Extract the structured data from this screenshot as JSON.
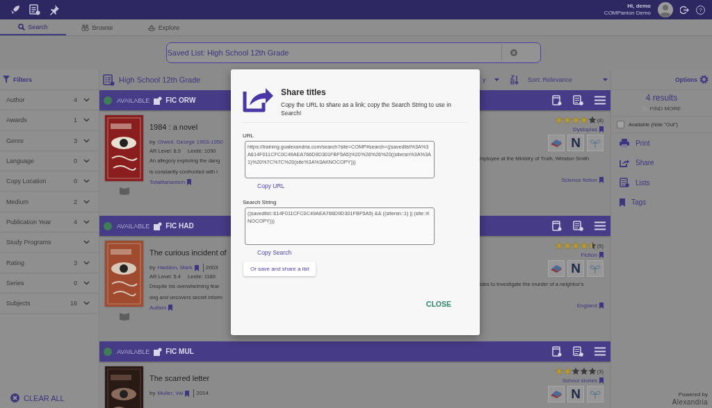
{
  "top_bar": {
    "greeting": "Hi, demo",
    "account": "COMPanion Demo",
    "help": "?"
  },
  "tabs": [
    {
      "label": "Search",
      "selected": true
    },
    {
      "label": "Browse",
      "selected": false
    },
    {
      "label": "Explore",
      "selected": false
    }
  ],
  "search": {
    "value": "Saved List: High School 12th Grade"
  },
  "filters": {
    "title": "Filters",
    "items": [
      {
        "label": "Author",
        "count": "4"
      },
      {
        "label": "Awards",
        "count": "1"
      },
      {
        "label": "Genre",
        "count": "3"
      },
      {
        "label": "Language",
        "count": "0"
      },
      {
        "label": "Copy Location",
        "count": "0"
      },
      {
        "label": "Medium",
        "count": "2"
      },
      {
        "label": "Publication Year",
        "count": "4"
      },
      {
        "label": "Study Programs"
      },
      {
        "label": "Rating",
        "count": "3"
      },
      {
        "label": "Series",
        "count": "0"
      },
      {
        "label": "Subjects",
        "count": "16"
      }
    ],
    "clear": "CLEAR ALL"
  },
  "results_header": {
    "list_name": "High School 12th Grade",
    "group_by": "y",
    "sort": "Sort: Relevance"
  },
  "results": [
    {
      "status": "AVAILABLE",
      "color": "#3f7d55",
      "call_number": "FIC ORW",
      "title": "1984 : a novel",
      "author_prefix": "by",
      "author": "Orwell, George 1903-1950",
      "author_bookmark": false,
      "ar_level": "AR Level: 8.9",
      "lexile": "Lexile: 1090",
      "description_left": [
        "An allegory exploring the dang",
        "is constantly confronted with l"
      ],
      "description_right": [
        "mployee at the Ministry of Truth, Winston Smith"
      ],
      "subject_left": "Totalitarianism",
      "subject_right": "Science fiction",
      "stars": 4,
      "rating_count": "(8)",
      "genre": "Dystopias",
      "resources": [
        {
          "kind": "books"
        },
        {
          "kind": "letter",
          "label": "N"
        },
        {
          "kind": "plant"
        }
      ]
    },
    {
      "status": "AVAILABLE",
      "color": "#3f7d55",
      "call_number": "FIC HAD",
      "title": "The curious incident of",
      "author_prefix": "by",
      "author": "Haddon, Mark",
      "author_bookmark": true,
      "year": "2003",
      "ar_level": "AR Level: 5.4",
      "lexile": "Lexile: 1180",
      "description_left": [
        "Despite his overwhelming fear",
        "dog and uncovers secret inform"
      ],
      "description_right": [
        "ides to investigate the murder of a neighbor's"
      ],
      "subject_left": "Autism",
      "subject_right": "England",
      "stars": 4.5,
      "rating_count": "(5)",
      "genre": "Fiction",
      "resources": [
        {
          "kind": "books"
        },
        {
          "kind": "letter",
          "label": "N"
        },
        {
          "kind": "plant"
        }
      ]
    },
    {
      "status": "AVAILABLE",
      "color": "#3f7d55",
      "call_number": "FIC MUL",
      "title": "The scarred letter",
      "author_prefix": "by",
      "author": "Muller, Val",
      "author_bookmark": true,
      "year": "2014",
      "stars": 2,
      "rating_count": "(3)",
      "genre": "School stories",
      "resources": [
        {
          "kind": "books"
        },
        {
          "kind": "letter",
          "label": "N"
        },
        {
          "kind": "plant"
        }
      ]
    }
  ],
  "options": {
    "title": "Options",
    "results_count": "4 results",
    "find_more": "FIND MORE",
    "available_filter": {
      "label": "Available (hide \"Out\")",
      "checked": false
    },
    "actions": [
      {
        "label": "Print"
      },
      {
        "label": "Share"
      },
      {
        "label": "Lists"
      },
      {
        "label": "Tags"
      }
    ]
  },
  "powered_by": {
    "label": "Powered by",
    "brand": "Alexandria"
  },
  "modal": {
    "title": "Share titles",
    "subtitle": "Copy the URL to share as a link; copy the Search String to use in Search!",
    "url_label": "URL",
    "url": "https://training.goalexandria.com/search?site=COMP#search=((savedlist%3A%3A614F011CFC0C49AEA766D9D301FBF5A5)%20%26%26%20((sitersn%3A%3A1)%20%7C%7C%20(site%3A%3AKNOCOPY)))",
    "copy_url": "Copy URL",
    "search_label": "Search String",
    "search_string": "((savedlist::614F011CFC0C49AEA766D9D301FBF5A5) && ((sitersn::1) || (site::KNOCOPY)))",
    "copy_search": "Copy Search",
    "save_list": "Or save and share a list",
    "close": "CLOSE"
  }
}
